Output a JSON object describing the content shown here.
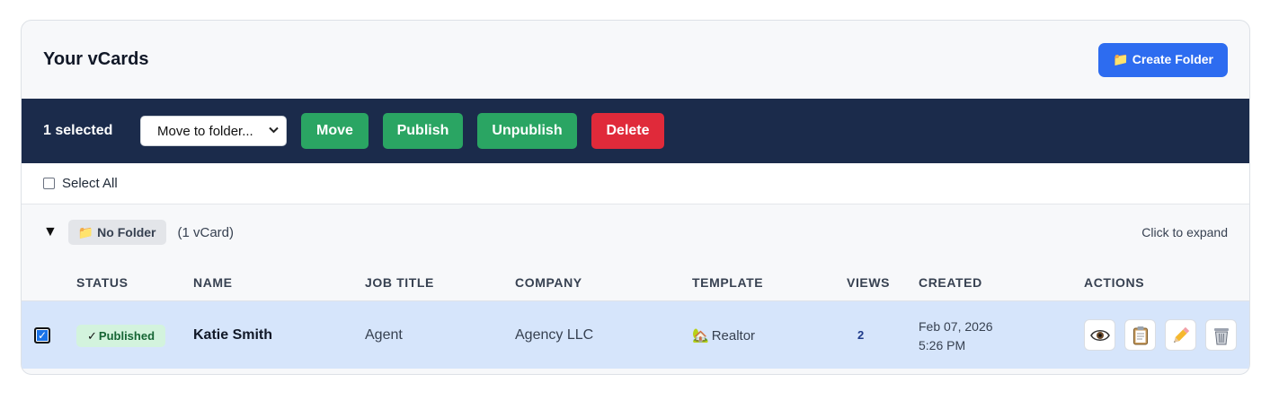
{
  "header": {
    "title": "Your vCards",
    "create_folder_label": "📁 Create Folder"
  },
  "bulk_bar": {
    "selected_text": "1 selected",
    "folder_select_value": "Move to folder...",
    "move_label": "Move",
    "publish_label": "Publish",
    "unpublish_label": "Unpublish",
    "delete_label": "Delete"
  },
  "select_all": {
    "label": "Select All",
    "checked": false
  },
  "folder": {
    "caret": "▼",
    "name": "📁 No Folder",
    "count": "(1 vCard)",
    "hint": "Click to expand"
  },
  "table": {
    "columns": [
      "STATUS",
      "NAME",
      "JOB TITLE",
      "COMPANY",
      "TEMPLATE",
      "VIEWS",
      "CREATED",
      "ACTIONS"
    ],
    "rows": [
      {
        "checked": true,
        "status": "Published",
        "name": "Katie Smith",
        "job_title": "Agent",
        "company": "Agency LLC",
        "template": "Realtor",
        "views": "2",
        "created_date": "Feb 07, 2026",
        "created_time": "5:26 PM"
      }
    ]
  },
  "colors": {
    "primary": "#2d6cf0",
    "bulk_bar": "#1b2b4b",
    "success": "#2aa563",
    "danger": "#e02a3a",
    "selected_row": "#d6e5fb"
  }
}
